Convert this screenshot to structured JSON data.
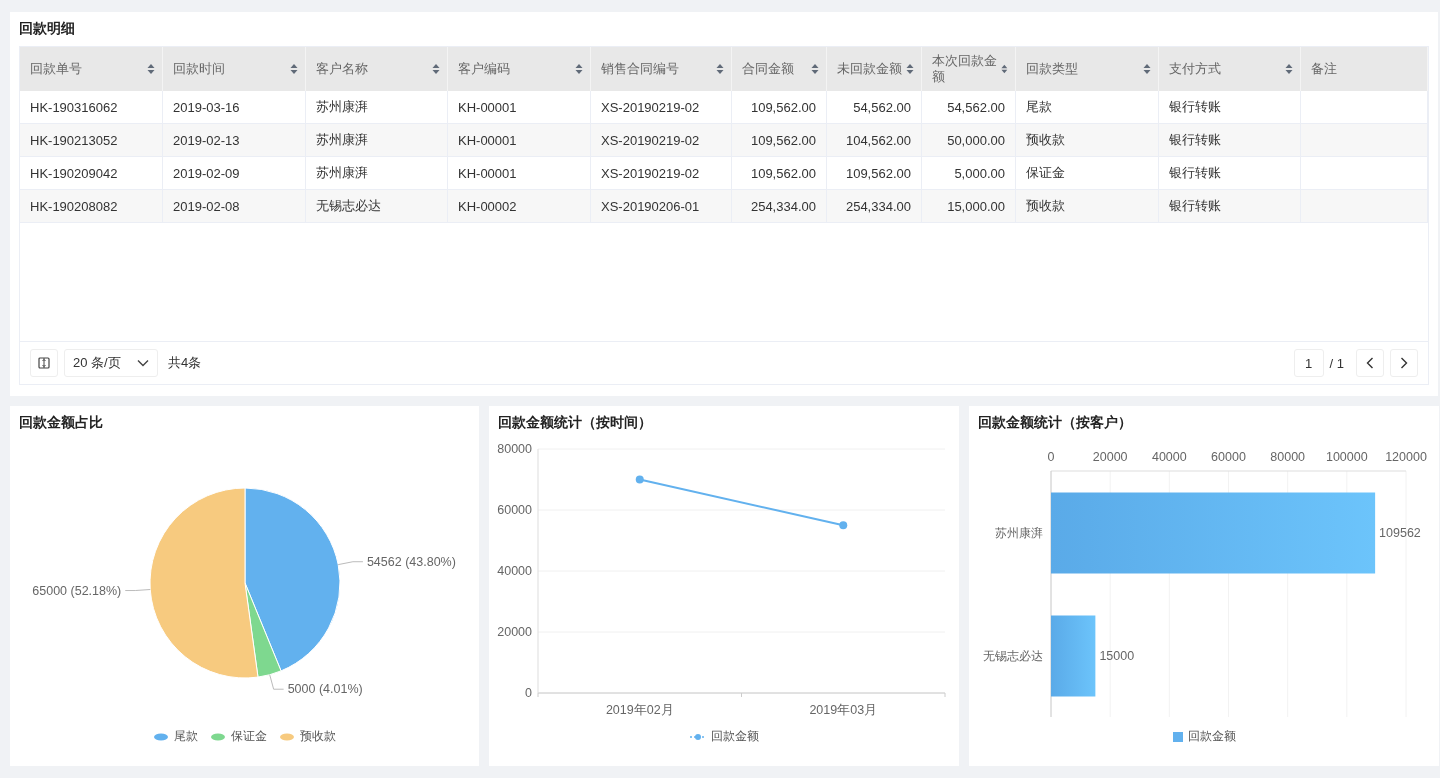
{
  "detail": {
    "title": "回款明细",
    "columns": [
      {
        "label": "回款单号",
        "kind": "text",
        "sortable": true
      },
      {
        "label": "回款时间",
        "kind": "text",
        "sortable": true
      },
      {
        "label": "客户名称",
        "kind": "text",
        "sortable": true
      },
      {
        "label": "客户编码",
        "kind": "text",
        "sortable": true
      },
      {
        "label": "销售合同编号",
        "kind": "text",
        "sortable": true
      },
      {
        "label": "合同金额",
        "kind": "amount",
        "sortable": true
      },
      {
        "label": "未回款金额",
        "kind": "amount",
        "sortable": true
      },
      {
        "label": "本次回款金额",
        "kind": "amount",
        "sortable": true
      },
      {
        "label": "回款类型",
        "kind": "text",
        "sortable": true
      },
      {
        "label": "支付方式",
        "kind": "text",
        "sortable": true
      },
      {
        "label": "备注",
        "kind": "text",
        "sortable": false
      }
    ],
    "rows": [
      [
        "HK-190316062",
        "2019-03-16",
        "苏州康湃",
        "KH-00001",
        "XS-20190219-02",
        "109,562.00",
        "54,562.00",
        "54,562.00",
        "尾款",
        "银行转账",
        ""
      ],
      [
        "HK-190213052",
        "2019-02-13",
        "苏州康湃",
        "KH-00001",
        "XS-20190219-02",
        "109,562.00",
        "104,562.00",
        "50,000.00",
        "预收款",
        "银行转账",
        ""
      ],
      [
        "HK-190209042",
        "2019-02-09",
        "苏州康湃",
        "KH-00001",
        "XS-20190219-02",
        "109,562.00",
        "109,562.00",
        "5,000.00",
        "保证金",
        "银行转账",
        ""
      ],
      [
        "HK-190208082",
        "2019-02-08",
        "无锡志必达",
        "KH-00002",
        "XS-20190206-01",
        "254,334.00",
        "254,334.00",
        "15,000.00",
        "预收款",
        "银行转账",
        ""
      ]
    ],
    "pagination": {
      "page_size": "20 条/页",
      "total": "共4条",
      "page": "1",
      "pages": "/ 1"
    }
  },
  "charts": [
    {
      "title": "回款金额占比",
      "chart_data": {
        "type": "pie",
        "categories": [
          "尾款",
          "保证金",
          "预收款"
        ],
        "values": [
          54562,
          5000,
          65000
        ],
        "colors": [
          "#62b1ee",
          "#7ed88f",
          "#f7ca7f"
        ],
        "value_labels": [
          "54562 (43.80%)",
          "5000 (4.01%)",
          "65000 (52.18%)"
        ],
        "legend": "bottom"
      }
    },
    {
      "title": "回款金额统计（按时间）",
      "chart_data": {
        "type": "line",
        "categories": [
          "2019年02月",
          "2019年03月"
        ],
        "series": [
          {
            "name": "回款金额",
            "color": "#62b1ee",
            "marker": "circle",
            "values": [
              70000,
              55000
            ]
          }
        ],
        "ylim": [
          0,
          80000
        ],
        "yticks": [
          0,
          20000,
          40000,
          60000,
          80000
        ],
        "grid": true,
        "legend": "bottom"
      }
    },
    {
      "title": "回款金额统计（按客户）",
      "chart_data": {
        "type": "bar",
        "orientation": "horizontal",
        "categories": [
          "苏州康湃",
          "无锡志必达"
        ],
        "series": [
          {
            "name": "回款金额",
            "color": "#62b1ee",
            "values": [
              109562,
              15000
            ]
          }
        ],
        "xlim": [
          0,
          120000
        ],
        "xticks": [
          0,
          20000,
          40000,
          60000,
          80000,
          100000,
          120000
        ],
        "data_labels": true,
        "grid": true,
        "legend": "bottom"
      }
    }
  ]
}
